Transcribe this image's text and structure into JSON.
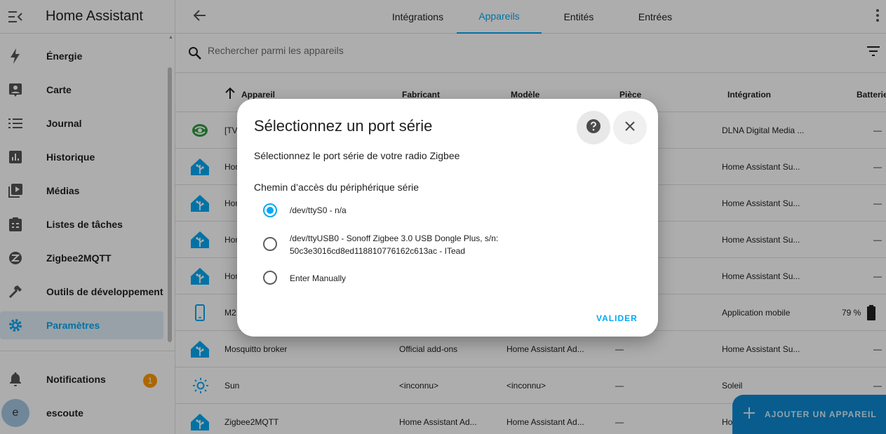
{
  "sidebar": {
    "title": "Home Assistant",
    "items": [
      {
        "label": "Énergie",
        "icon": "lightning-icon"
      },
      {
        "label": "Carte",
        "icon": "map-icon"
      },
      {
        "label": "Journal",
        "icon": "list-icon"
      },
      {
        "label": "Historique",
        "icon": "chart-icon"
      },
      {
        "label": "Médias",
        "icon": "play-icon"
      },
      {
        "label": "Listes de tâches",
        "icon": "clipboard-icon"
      },
      {
        "label": "Zigbee2MQTT",
        "icon": "zigbee-icon"
      },
      {
        "label": "Outils de développement",
        "icon": "hammer-icon"
      },
      {
        "label": "Paramètres",
        "icon": "gear-icon"
      }
    ],
    "notifications": {
      "label": "Notifications",
      "count": "1"
    },
    "user": {
      "initial": "e",
      "name": "escoute"
    }
  },
  "tabs": [
    "Intégrations",
    "Appareils",
    "Entités",
    "Entrées"
  ],
  "active_tab": "Appareils",
  "search": {
    "placeholder": "Rechercher parmi les appareils"
  },
  "table": {
    "headers": {
      "device": "Appareil",
      "maker": "Fabricant",
      "model": "Modèle",
      "room": "Pièce",
      "integration": "Intégration",
      "battery": "Batterie"
    },
    "rows": [
      {
        "name": "[TV",
        "maker": "",
        "model": "",
        "room": "",
        "integration": "DLNA Digital Media ...",
        "battery": "—"
      },
      {
        "name": "Hom",
        "maker": "",
        "model": "",
        "room": "",
        "integration": "Home Assistant Su...",
        "battery": "—"
      },
      {
        "name": "Hom",
        "maker": "",
        "model": "",
        "room": "",
        "integration": "Home Assistant Su...",
        "battery": "—"
      },
      {
        "name": "Hom",
        "maker": "",
        "model": "",
        "room": "",
        "integration": "Home Assistant Su...",
        "battery": "—"
      },
      {
        "name": "Hom",
        "maker": "",
        "model": "",
        "room": "",
        "integration": "Home Assistant Su...",
        "battery": "—"
      },
      {
        "name": "M2",
        "maker": "",
        "model": "",
        "room": "",
        "integration": "Application mobile",
        "battery": "79 %"
      },
      {
        "name": "Mosquitto broker",
        "maker": "Official add-ons",
        "model": "Home Assistant Ad...",
        "room": "—",
        "integration": "Home Assistant Su...",
        "battery": "—"
      },
      {
        "name": "Sun",
        "maker": "<inconnu>",
        "model": "<inconnu>",
        "room": "—",
        "integration": "Soleil",
        "battery": "—"
      },
      {
        "name": "Zigbee2MQTT",
        "maker": "Home Assistant Ad...",
        "model": "Home Assistant Ad...",
        "room": "—",
        "integration": "Hom",
        "battery": ""
      }
    ]
  },
  "dialog": {
    "title": "Sélectionnez un port série",
    "description": "Sélectionnez le port série de votre radio Zigbee",
    "field_label": "Chemin d’accès du périphérique série",
    "options": [
      {
        "line1": "/dev/ttyS0 - n/a",
        "line2": ""
      },
      {
        "line1": "/dev/ttyUSB0 - Sonoff Zigbee 3.0 USB Dongle Plus, s/n:",
        "line2": "50c3e3016cd8ed118810776162c613ac - ITead"
      },
      {
        "line1": "Enter Manually",
        "line2": ""
      }
    ],
    "selected_option": "/dev/ttyS0 - n/a",
    "submit_label": "VALIDER"
  },
  "fab": {
    "label": "AJOUTER UN APPAREIL"
  },
  "colors": {
    "accent": "#03a9f4",
    "badge": "#ff9800",
    "ha_icon": "#03a9f4"
  }
}
